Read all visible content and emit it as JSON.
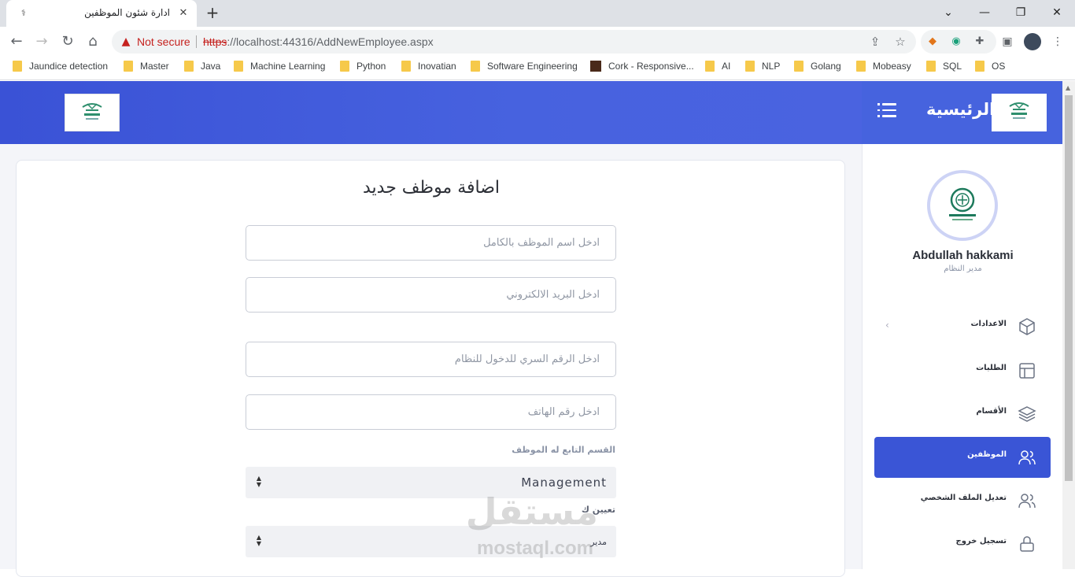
{
  "browser": {
    "tab_title": "ادارة شئون الموظفين",
    "tab_favicon": "hospital-favicon-icon",
    "not_secure": "Not secure",
    "url_protocol": "https",
    "url_rest": "://localhost:44316/AddNewEmployee.aspx",
    "bookmarks": [
      "Jaundice detection",
      "Master",
      "Java",
      "Machine Learning",
      "Python",
      "Inovatian",
      "Software Engineering",
      "Cork - Responsive...",
      "AI",
      "NLP",
      "Golang",
      "Mobeasy",
      "SQL",
      "OS"
    ]
  },
  "header": {
    "brand_title": "الرئيسية"
  },
  "sidebar": {
    "user_name": "Abdullah hakkami",
    "user_role": "مدير النظام",
    "items": [
      {
        "label": "الاعدادات",
        "icon": "cube-icon",
        "active": false
      },
      {
        "label": "الطلبات",
        "icon": "layout-icon",
        "active": false
      },
      {
        "label": "الأقسام",
        "icon": "layers-icon",
        "active": false
      },
      {
        "label": "الموظفين",
        "icon": "users-icon",
        "active": true
      },
      {
        "label": "تعديل الملف الشخصي",
        "icon": "user-edit-icon",
        "active": false
      },
      {
        "label": "تسجيل خروج",
        "icon": "lock-icon",
        "active": false
      }
    ]
  },
  "form": {
    "title": "اضافة موظف جديد",
    "name_placeholder": "ادخل اسم الموظف بالكامل",
    "email_placeholder": "ادخل البريد الالكتروني",
    "password_placeholder": "ادخل الرقم السري للدخول للنظام",
    "phone_placeholder": "ادخل رقم الهاتف",
    "department_label": "القسم التابع له الموظف",
    "department_value": "Management",
    "role_label": "تعيين ك",
    "role_value": "مدير"
  },
  "watermark": {
    "arabic": "مستقل",
    "latin": "mostaql.com"
  },
  "colors": {
    "header_blue": "#4762df",
    "active_nav": "#3a55d6"
  }
}
